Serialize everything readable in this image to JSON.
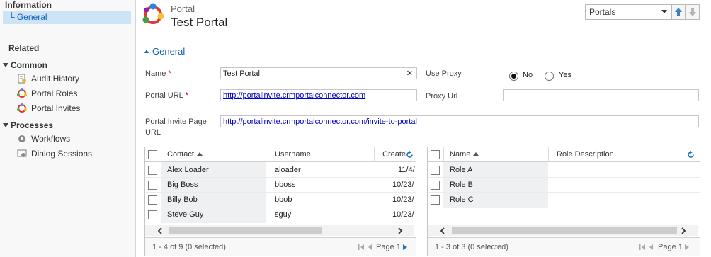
{
  "nav": {
    "information_header": "Information",
    "general": "└ General",
    "related_header": "Related",
    "common_group": "Common",
    "common_items": [
      "Audit History",
      "Portal Roles",
      "Portal Invites"
    ],
    "processes_group": "Processes",
    "process_items": [
      "Workflows",
      "Dialog Sessions"
    ]
  },
  "header": {
    "entity": "Portal",
    "title": "Test Portal",
    "selector_value": "Portals"
  },
  "section": {
    "title": "General"
  },
  "form": {
    "name_label": "Name",
    "name_value": "Test Portal",
    "clear_glyph": "✕",
    "url_label": "Portal URL",
    "url_value": "http://portalinvite.crmportalconnector.com",
    "invite_label_1": "Portal Invite Page",
    "invite_label_2": "URL",
    "invite_value": "http://portalinvite.crmportalconnector.com/invite-to-portal",
    "proxy_label": "Use Proxy",
    "no_label": "No",
    "yes_label": "Yes",
    "proxy_url_label": "Proxy Url",
    "proxy_url_value": "",
    "required_mark": "*"
  },
  "contacts_grid": {
    "headers": [
      "Contact",
      "Username",
      "Create"
    ],
    "rows": [
      [
        "Alex Loader",
        "aloader",
        "11/4/"
      ],
      [
        "Big Boss",
        "bboss",
        "10/23/"
      ],
      [
        "Billy Bob",
        "bbob",
        "10/23/"
      ],
      [
        "Steve Guy",
        "sguy",
        "10/23/"
      ]
    ],
    "footer": "1 - 4 of 9 (0 selected)",
    "page": "Page 1"
  },
  "roles_grid": {
    "headers": [
      "Name",
      "Role Description"
    ],
    "rows": [
      [
        "Role A",
        ""
      ],
      [
        "Role B",
        ""
      ],
      [
        "Role C",
        ""
      ]
    ],
    "footer": "1 - 3 of 3 (0 selected)",
    "page": "Page 1"
  },
  "colors": {
    "accent": "#1160b7",
    "selection": "#cde4f7",
    "required": "#cc0000",
    "link": "#0000cc"
  },
  "icons": [
    "audit-history-icon",
    "portal-roles-icon",
    "portal-invites-icon",
    "workflows-icon",
    "dialog-sessions-icon",
    "refresh-icon",
    "portal-logo-icon"
  ]
}
